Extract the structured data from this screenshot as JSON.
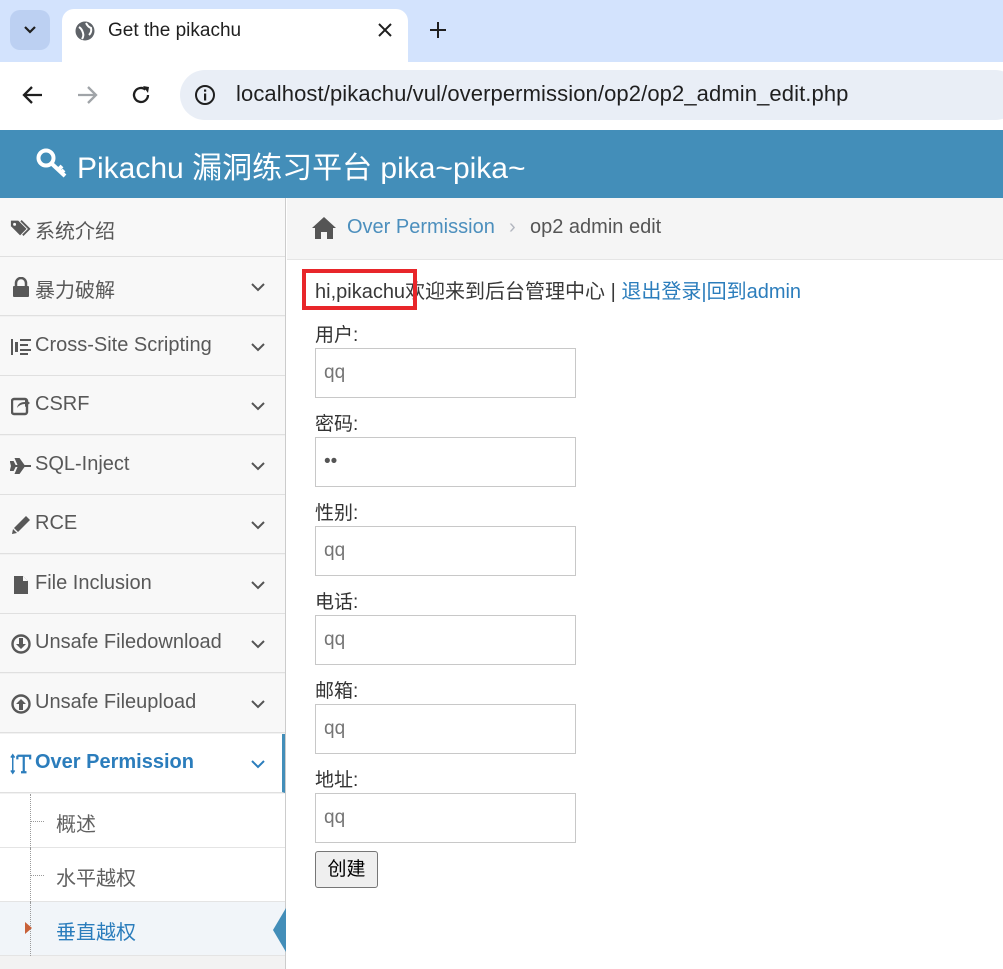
{
  "browser": {
    "tab_title": "Get the pikachu",
    "url": "localhost/pikachu/vul/overpermission/op2/op2_admin_edit.php"
  },
  "header": {
    "brand": "Pikachu 漏洞练习平台 pika~pika~"
  },
  "sidebar": {
    "items": [
      {
        "label": "系统介绍",
        "icon": "tags-icon",
        "expandable": false
      },
      {
        "label": "暴力破解",
        "icon": "lock-icon",
        "expandable": true
      },
      {
        "label": "Cross-Site Scripting",
        "icon": "indent-icon",
        "expandable": true
      },
      {
        "label": "CSRF",
        "icon": "share-icon",
        "expandable": true
      },
      {
        "label": "SQL-Inject",
        "icon": "plane-icon",
        "expandable": true
      },
      {
        "label": "RCE",
        "icon": "pencil-icon",
        "expandable": true
      },
      {
        "label": "File Inclusion",
        "icon": "file-icon",
        "expandable": true
      },
      {
        "label": "Unsafe Filedownload",
        "icon": "download-icon",
        "expandable": true
      },
      {
        "label": "Unsafe Fileupload",
        "icon": "upload-icon",
        "expandable": true
      },
      {
        "label": "Over Permission",
        "icon": "text-height-icon",
        "expandable": true,
        "active": true
      }
    ],
    "subitems": [
      {
        "label": "概述"
      },
      {
        "label": "水平越权"
      },
      {
        "label": "垂直越权",
        "current": true
      }
    ]
  },
  "breadcrumb": {
    "section": "Over Permission",
    "separator": "›",
    "page": "op2 admin edit"
  },
  "greeting": {
    "user": "hi,pikachu",
    "welcome": "欢迎来到后台管理中心 | ",
    "logout": "退出登录",
    "divider": "|",
    "back": "回到admin"
  },
  "form": {
    "username_label": "用户:",
    "username_placeholder": "qq",
    "password_label": "密码:",
    "password_value": "••",
    "sex_label": "性别:",
    "sex_placeholder": "qq",
    "phone_label": "电话:",
    "phone_placeholder": "qq",
    "email_label": "邮箱:",
    "email_placeholder": "qq",
    "address_label": "地址:",
    "address_placeholder": "qq",
    "submit_label": "创建"
  },
  "colors": {
    "header_bg": "#438eb9",
    "link": "#2b7dbc",
    "highlight": "#e8262a"
  }
}
